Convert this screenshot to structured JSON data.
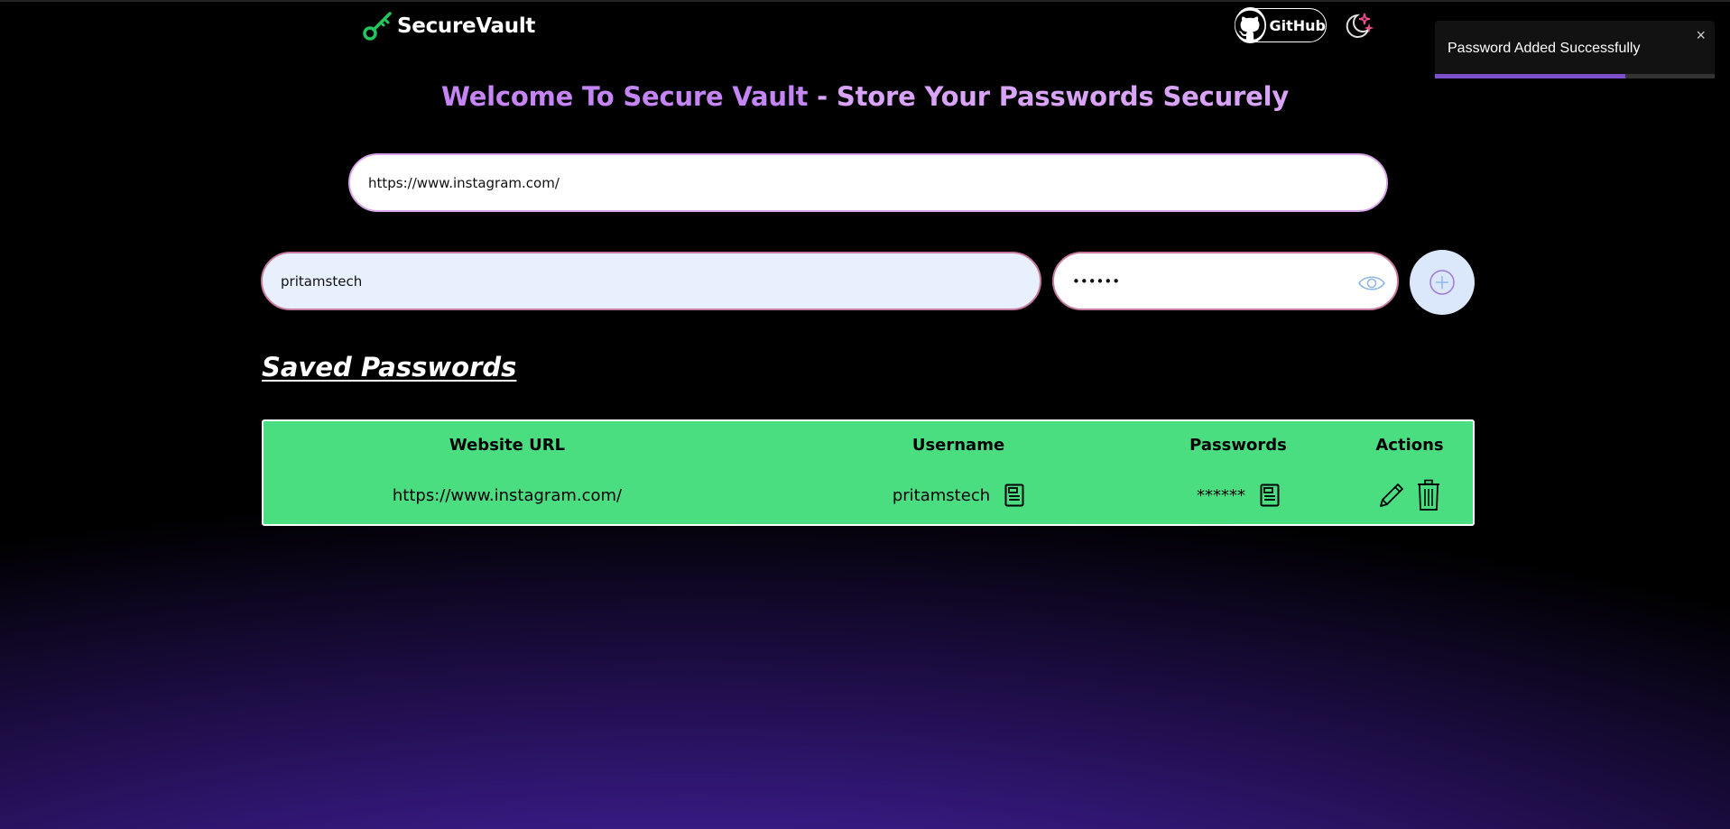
{
  "header": {
    "brand": "SecureVault",
    "github_label": "GitHub"
  },
  "toast": {
    "message": "Password Added Successfully",
    "close": "×",
    "progress_fraction": 0.68,
    "progress_color": "#7b4fc9"
  },
  "hero": {
    "title_part1": "Welcome To Secure Vault",
    "title_part2": " - Store Your Passwords Securely"
  },
  "form": {
    "url_value": "https://www.instagram.com/",
    "username_value": "pritamstech",
    "password_value": "••••••"
  },
  "saved": {
    "title": "Saved Passwords",
    "columns": [
      "Website URL",
      "Username",
      "Passwords",
      "Actions"
    ],
    "rows": [
      {
        "url": "https://www.instagram.com/",
        "username": "pritamstech",
        "password": "******"
      }
    ]
  },
  "colors": {
    "accent": "#c585f5",
    "table_bg": "#4ade80",
    "logo_green": "#22c55e"
  },
  "icons": [
    "key-icon",
    "github-icon",
    "theme-toggle-icon",
    "eye-icon",
    "add-icon",
    "copy-icon",
    "edit-icon",
    "delete-icon",
    "close-icon"
  ]
}
